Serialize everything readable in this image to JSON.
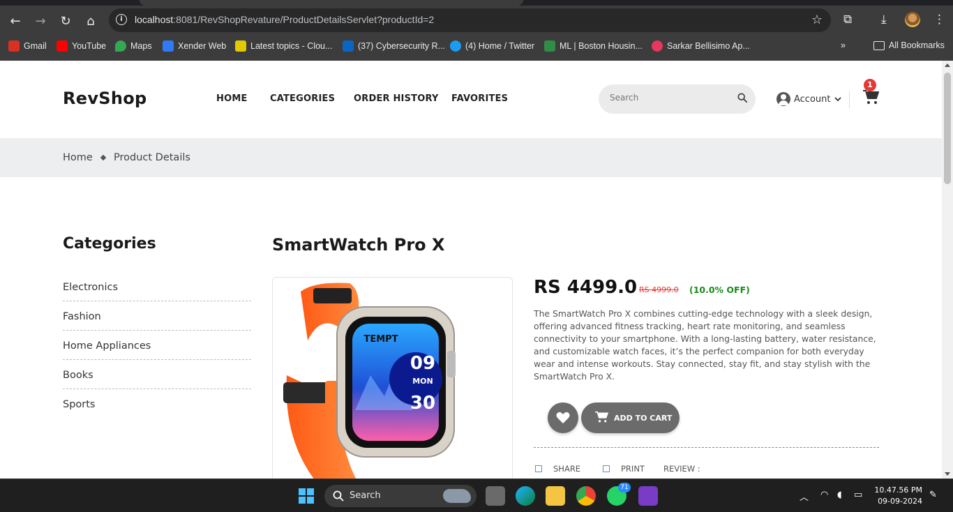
{
  "browser": {
    "url_host": "localhost",
    "url_rest": ":8081/RevShopRevature/ProductDetailsServlet?productId=2",
    "bookmarks": [
      {
        "label": "Gmail",
        "color": "#d93025"
      },
      {
        "label": "YouTube",
        "color": "#ff0000"
      },
      {
        "label": "Maps",
        "color": "#34a853"
      },
      {
        "label": "Xender Web",
        "color": "#2f7bf5"
      },
      {
        "label": "Latest topics - Clou...",
        "color": "#e2c900"
      },
      {
        "label": "(37) Cybersecurity R...",
        "color": "#0a66c2"
      },
      {
        "label": "(4) Home / Twitter",
        "color": "#1d9bf0"
      },
      {
        "label": "ML | Boston Housin...",
        "color": "#2f8d46"
      },
      {
        "label": "Sarkar Bellisimo Ap...",
        "color": "#e8365d"
      }
    ],
    "all_bookmarks": "All Bookmarks"
  },
  "header": {
    "logo": "RevShop",
    "nav": [
      "HOME",
      "CATEGORIES",
      "ORDER HISTORY",
      "FAVORITES"
    ],
    "search_placeholder": "Search",
    "account": "Account",
    "cart_count": "1"
  },
  "breadcrumb": {
    "home": "Home",
    "current": "Product Details"
  },
  "sidebar": {
    "title": "Categories",
    "items": [
      "Electronics",
      "Fashion",
      "Home Appliances",
      "Books",
      "Sports"
    ]
  },
  "product": {
    "name": "SmartWatch Pro X",
    "price": "RS 4499.0",
    "old_price": "RS 4999.0",
    "discount": "(10.0% OFF)",
    "description": "The SmartWatch Pro X combines cutting-edge technology with a sleek design, offering advanced fitness tracking, heart rate monitoring, and seamless connectivity to your smartphone. With a long-lasting battery, water resistance, and customizable watch faces, it’s the perfect companion for both everyday wear and intense workouts. Stay connected, stay fit, and stay stylish with the SmartWatch Pro X.",
    "add_to_cart": "ADD TO CART",
    "share": "SHARE",
    "print": "PRINT",
    "review": "REVIEW :",
    "watch_brand": "TEMPT",
    "watch_hour": "09",
    "watch_day": "MON",
    "watch_min": "30"
  },
  "taskbar": {
    "search": "Search",
    "whatsapp_badge": "71",
    "time": "10.47.56 PM",
    "date": "09-09-2024"
  }
}
